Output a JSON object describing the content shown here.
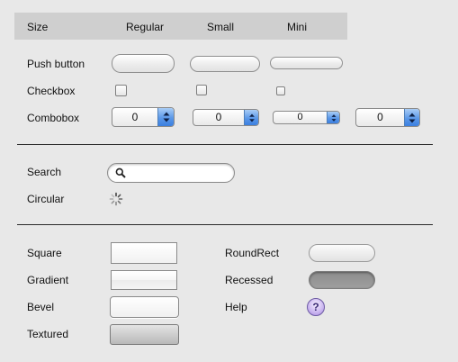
{
  "header": {
    "size_label": "Size",
    "regular_label": "Regular",
    "small_label": "Small",
    "mini_label": "Mini"
  },
  "rows": {
    "push_button_label": "Push button",
    "checkbox_label": "Checkbox",
    "combobox_label": "Combobox",
    "search_label": "Search",
    "circular_label": "Circular",
    "square_label": "Square",
    "gradient_label": "Gradient",
    "bevel_label": "Bevel",
    "textured_label": "Textured",
    "roundrect_label": "RoundRect",
    "recessed_label": "Recessed",
    "help_label": "Help"
  },
  "combos": {
    "regular_value": "0",
    "small_value": "0",
    "mini_value": "0",
    "extra_value": "0"
  },
  "help_button": {
    "glyph": "?"
  },
  "icons": {
    "search": "search-icon",
    "spinner": "spinner-icon",
    "stepper": "up-down-arrows-icon"
  },
  "colors": {
    "accent": "#5b98e8",
    "help": "#c9b4ef",
    "header_bg": "#cfcfcf"
  }
}
